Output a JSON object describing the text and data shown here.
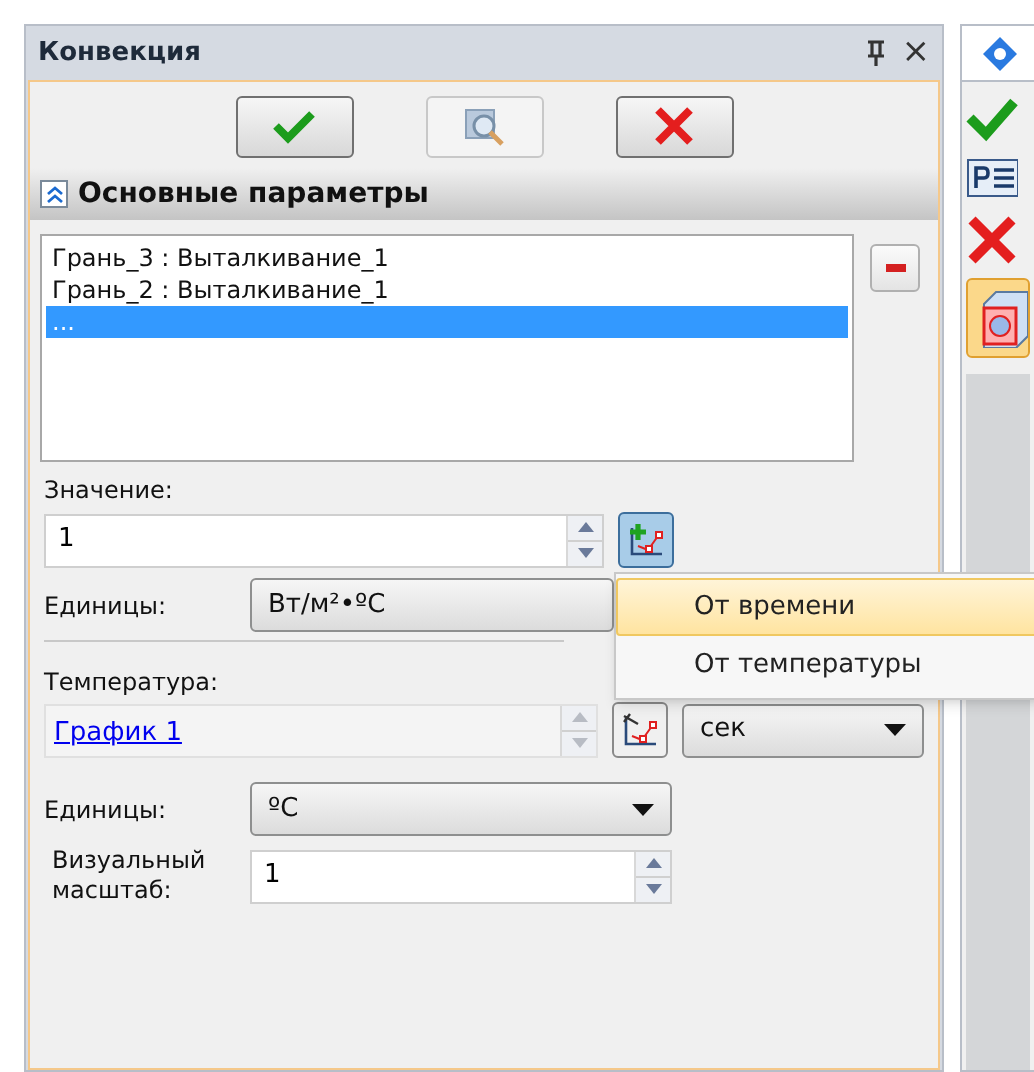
{
  "panel": {
    "title": "Конвекция",
    "close": "×"
  },
  "actions": [
    {
      "kind": "apply",
      "disabled": false
    },
    {
      "kind": "preview",
      "disabled": true
    },
    {
      "kind": "cancel",
      "disabled": false
    }
  ],
  "section": {
    "title": "Основные параметры",
    "expanded": true
  },
  "faces": [
    {
      "text": "Грань_3 : Выталкивание_1",
      "selected": false
    },
    {
      "text": "Грань_2 : Выталкивание_1",
      "selected": false
    },
    {
      "text": "...",
      "selected": true
    }
  ],
  "value": {
    "label": "Значение:",
    "value": "1"
  },
  "value_units": {
    "label": "Единицы:",
    "value": "Вт/м²•ºС"
  },
  "temperature": {
    "label": "Температура:",
    "link": "График 1",
    "units": "сек"
  },
  "temp_units": {
    "label": "Единицы:",
    "value": "ºС"
  },
  "scale": {
    "label": "Визуальный масштаб:",
    "value": "1"
  },
  "menu": [
    {
      "text": "От времени",
      "selected": true
    },
    {
      "text": "От температуры",
      "selected": false
    }
  ]
}
